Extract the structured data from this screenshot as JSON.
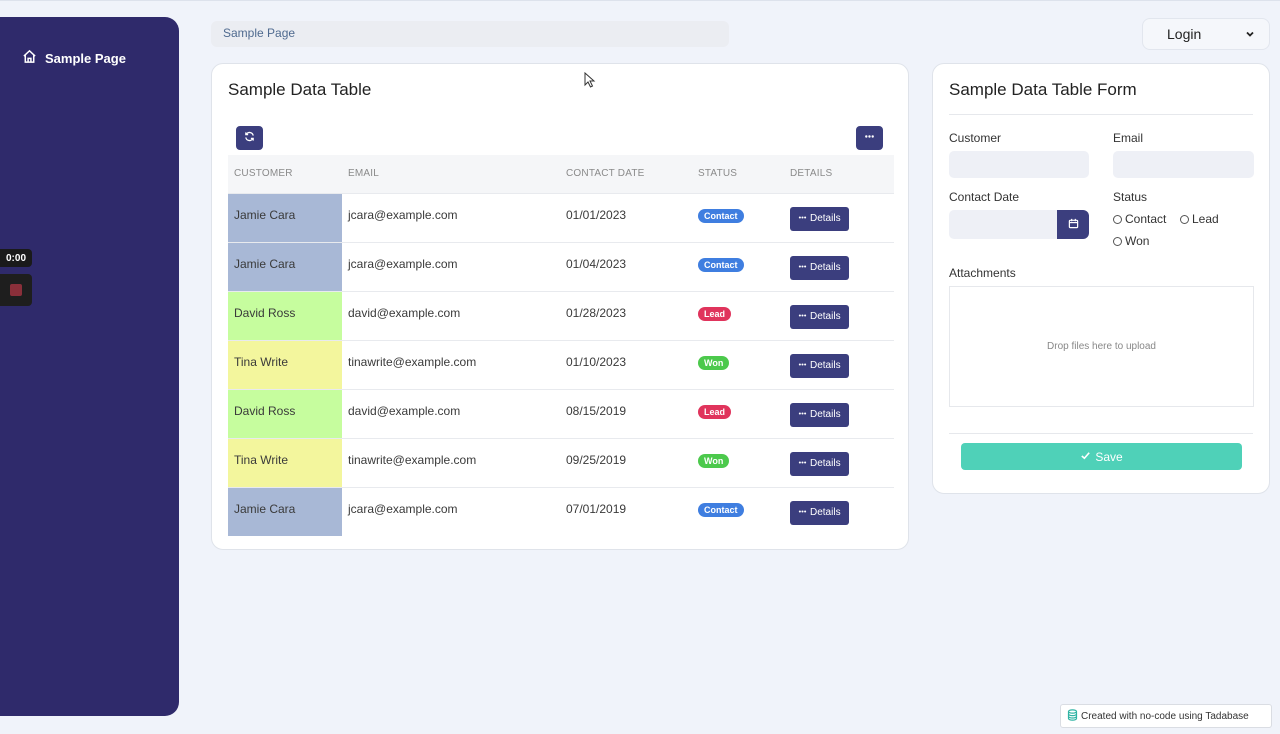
{
  "sidebar": {
    "item_label": "Sample Page",
    "recorder_time": "0:00"
  },
  "breadcrumb": {
    "label": "Sample Page"
  },
  "login": {
    "label": "Login"
  },
  "table_card": {
    "title": "Sample Data Table",
    "columns": [
      "CUSTOMER",
      "EMAIL",
      "CONTACT DATE",
      "STATUS",
      "DETAILS"
    ],
    "details_label": "Details",
    "rows": [
      {
        "customer": "Jamie Cara",
        "email": "jcara@example.com",
        "date": "01/01/2023",
        "status": "Contact",
        "row_color": "#a8b8d6",
        "status_color": "#3f7ee0"
      },
      {
        "customer": "Jamie Cara",
        "email": "jcara@example.com",
        "date": "01/04/2023",
        "status": "Contact",
        "row_color": "#a8b8d6",
        "status_color": "#3f7ee0"
      },
      {
        "customer": "David Ross",
        "email": "david@example.com",
        "date": "01/28/2023",
        "status": "Lead",
        "row_color": "#c6fd9e",
        "status_color": "#e0345c"
      },
      {
        "customer": "Tina Write",
        "email": "tinawrite@example.com",
        "date": "01/10/2023",
        "status": "Won",
        "row_color": "#f3f69d",
        "status_color": "#4cc94c"
      },
      {
        "customer": "David Ross",
        "email": "david@example.com",
        "date": "08/15/2019",
        "status": "Lead",
        "row_color": "#c6fd9e",
        "status_color": "#e0345c"
      },
      {
        "customer": "Tina Write",
        "email": "tinawrite@example.com",
        "date": "09/25/2019",
        "status": "Won",
        "row_color": "#f3f69d",
        "status_color": "#4cc94c"
      },
      {
        "customer": "Jamie Cara",
        "email": "jcara@example.com",
        "date": "07/01/2019",
        "status": "Contact",
        "row_color": "#a8b8d6",
        "status_color": "#3f7ee0"
      }
    ]
  },
  "form_card": {
    "title": "Sample Data Table Form",
    "customer_label": "Customer",
    "email_label": "Email",
    "contact_date_label": "Contact Date",
    "status_label": "Status",
    "status_options": [
      "Contact",
      "Lead",
      "Won"
    ],
    "attachments_label": "Attachments",
    "dropzone_text": "Drop files here to upload",
    "save_label": "Save"
  },
  "footer": {
    "badge_text": "Created with no-code using Tadabase"
  },
  "colors": {
    "sidebar": "#2f2a6b",
    "button": "#3b3e7e",
    "save": "#4fd1b8",
    "background": "#f0f3fa"
  }
}
